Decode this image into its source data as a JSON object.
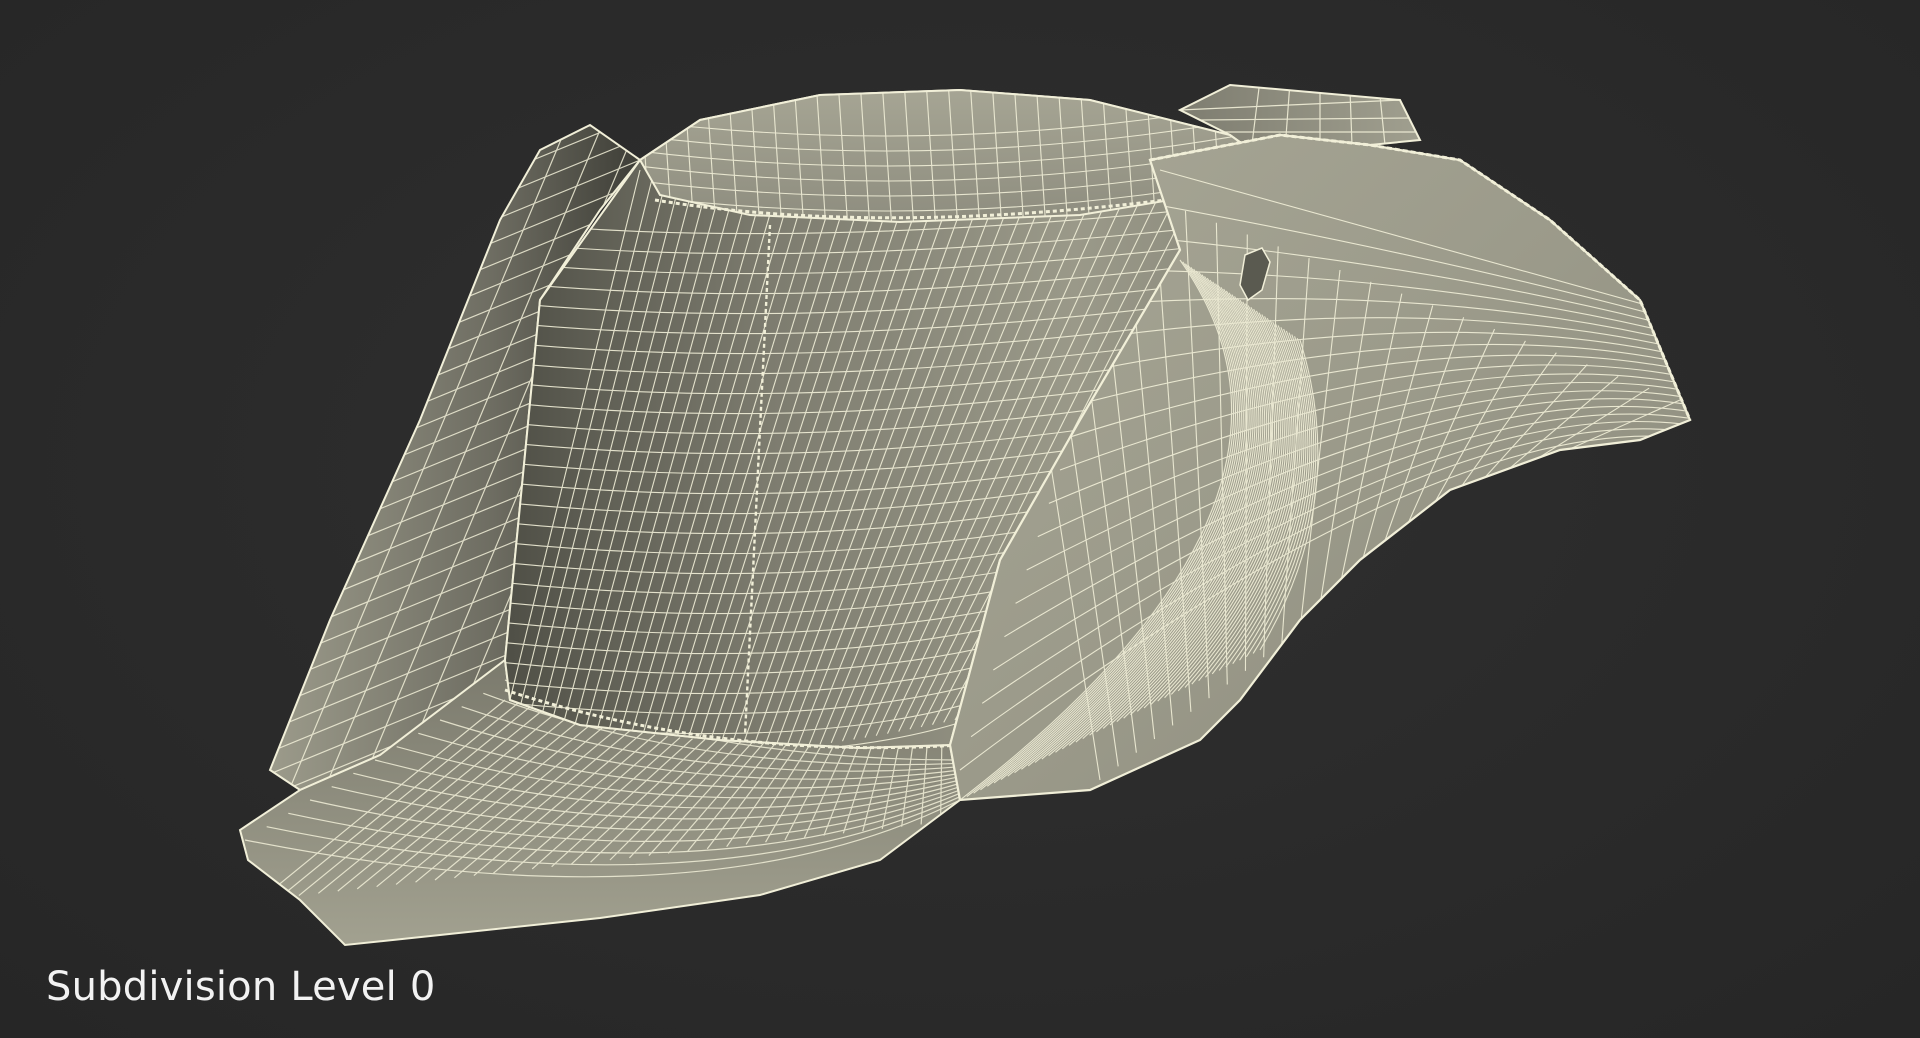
{
  "viewport": {
    "background": "#2b2b2b",
    "subject": "tricorn-hat-icon",
    "surface_color": "#8d8c7e",
    "wire_color": "#f1efd8"
  },
  "caption": {
    "label": "Subdivision Level 0"
  }
}
